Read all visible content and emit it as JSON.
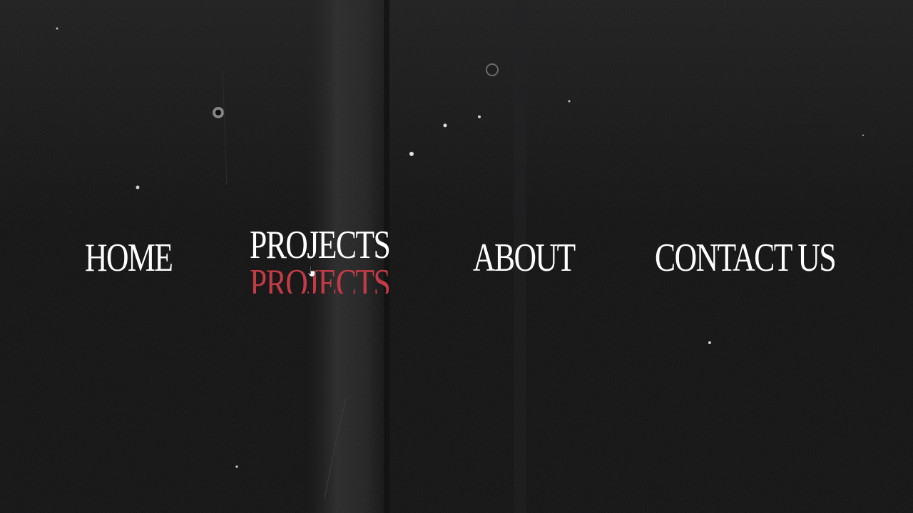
{
  "colors": {
    "background": "#101011",
    "text": "#ffffff",
    "accent": "#c23b45"
  },
  "nav": {
    "home": "HOME",
    "projects": "PROJECTS",
    "about": "ABOUT",
    "contact": "CONTACT US"
  },
  "cursor": {
    "icon": "hand-pointer-icon"
  }
}
